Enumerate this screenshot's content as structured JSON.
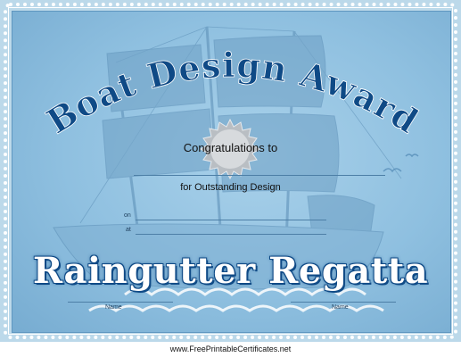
{
  "certificate": {
    "title": "Boat Design Award",
    "congratulations": "Congratulations to",
    "for_line": "for Outstanding Design",
    "on_label": "on",
    "at_label": "at",
    "event_name": "Raingutter Regatta",
    "name_left_label": "Name",
    "name_right_label": "Name"
  },
  "footer": {
    "site": "www.FreePrintableCertificates.net"
  },
  "colors": {
    "title_blue": "#0f4a86",
    "background_blue": "#8fc0e0",
    "border_light": "#bcd9ea"
  }
}
